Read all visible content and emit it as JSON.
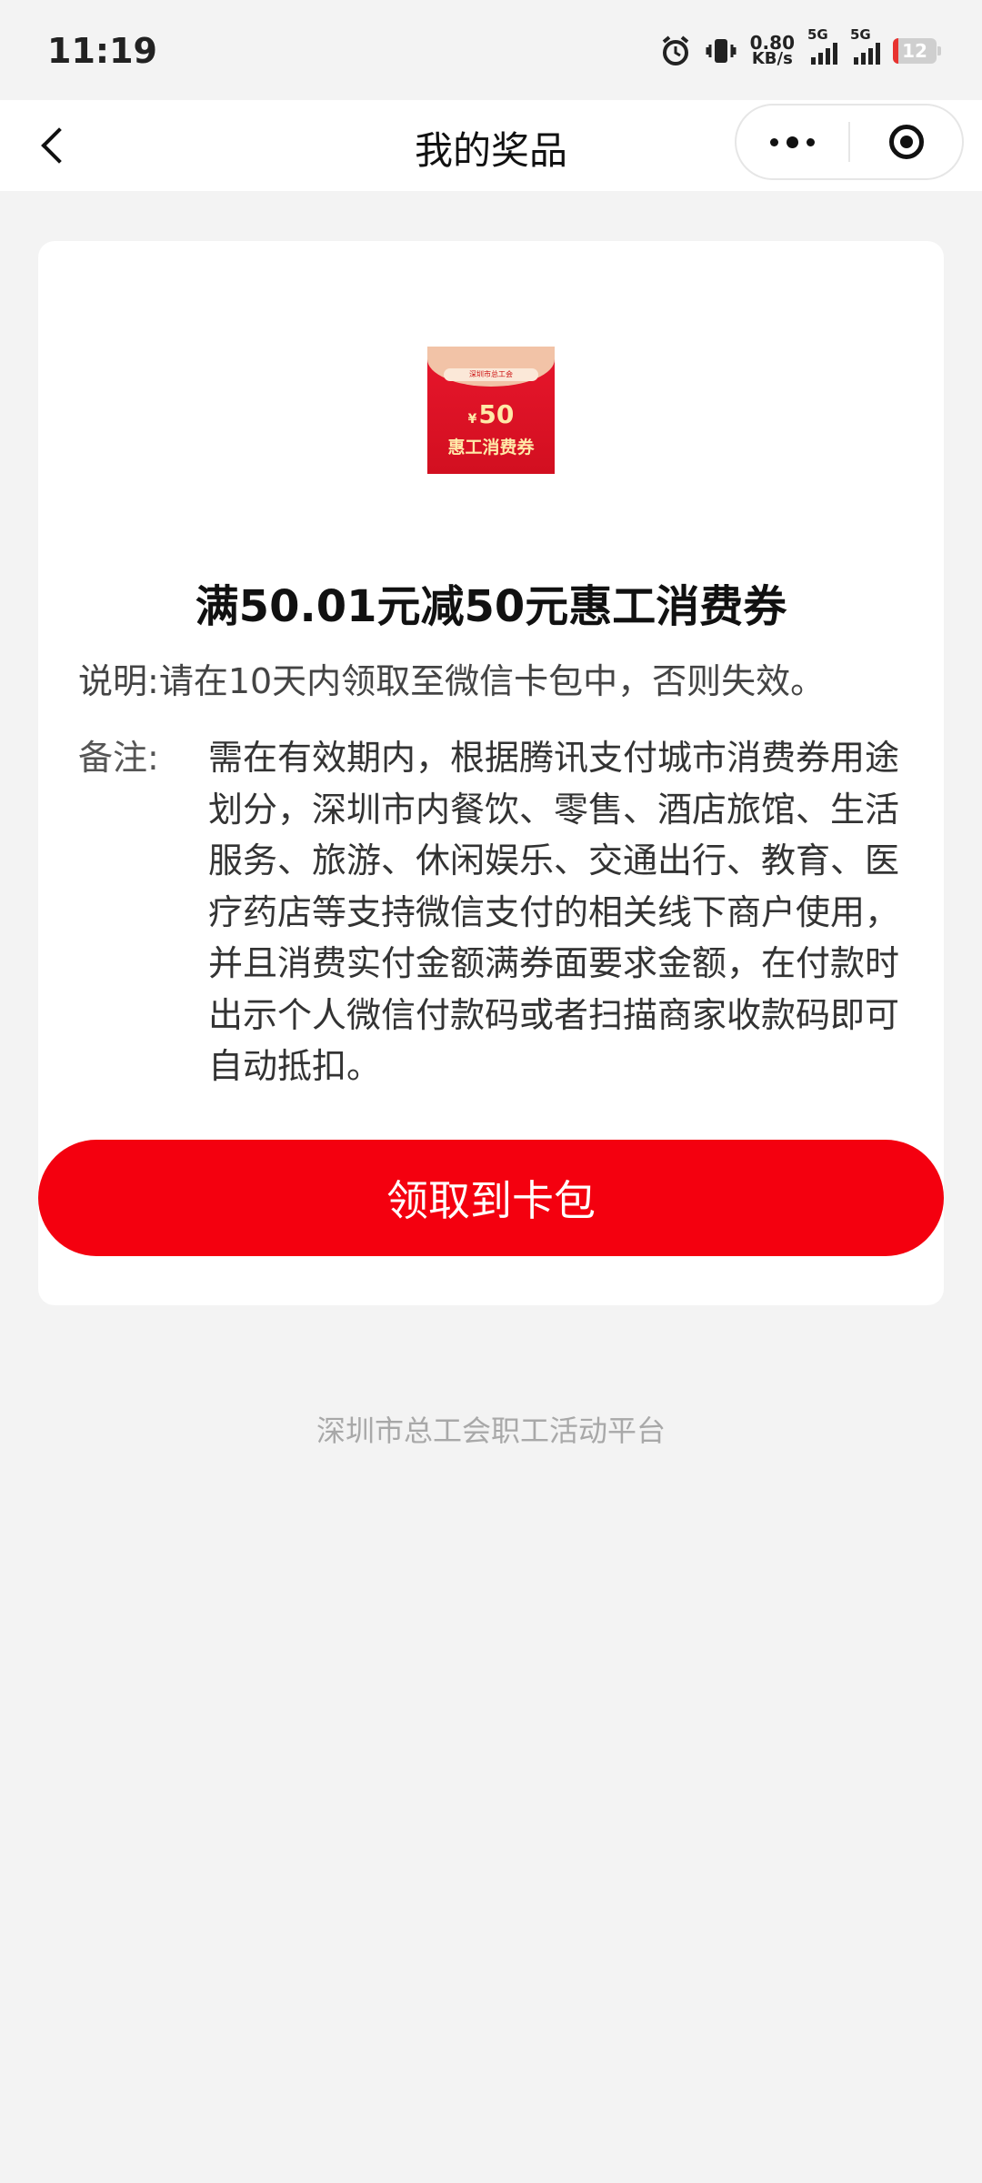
{
  "status_bar": {
    "time": "11:19",
    "net_speed_value": "0.80",
    "net_speed_unit": "KB/s",
    "sim1_label": "5G",
    "sim2_label": "5G",
    "battery_level": "12",
    "icons": [
      "alarm-icon",
      "vibrate-icon",
      "signal-icon",
      "battery-icon"
    ]
  },
  "nav": {
    "title": "我的奖品",
    "back_icon": "chevron-left-icon",
    "menu_icon": "more-dots-icon",
    "close_icon": "target-icon"
  },
  "prize": {
    "image": {
      "org_text": "深圳市总工会",
      "currency": "¥",
      "amount": "50",
      "caption": "惠工消费券"
    },
    "title": "满50.01元减50元惠工消费券",
    "description_label": "说明:",
    "description_text": "请在10天内领取至微信卡包中，否则失效。",
    "note_label": "备注:",
    "note_text": "需在有效期内，根据腾讯支付城市消费券用途划分，深圳市内餐饮、零售、酒店旅馆、生活服务、旅游、休闲娱乐、交通出行、教育、医疗药店等支持微信支付的相关线下商户使用，并且消费实付金额满券面要求金额，在付款时出示个人微信付款码或者扫描商家收款码即可自动抵扣。",
    "claim_button": "领取到卡包"
  },
  "footer": {
    "text": "深圳市总工会职工活动平台"
  },
  "colors": {
    "accent": "#f4000f",
    "background": "#f3f3f3",
    "card": "#ffffff"
  }
}
